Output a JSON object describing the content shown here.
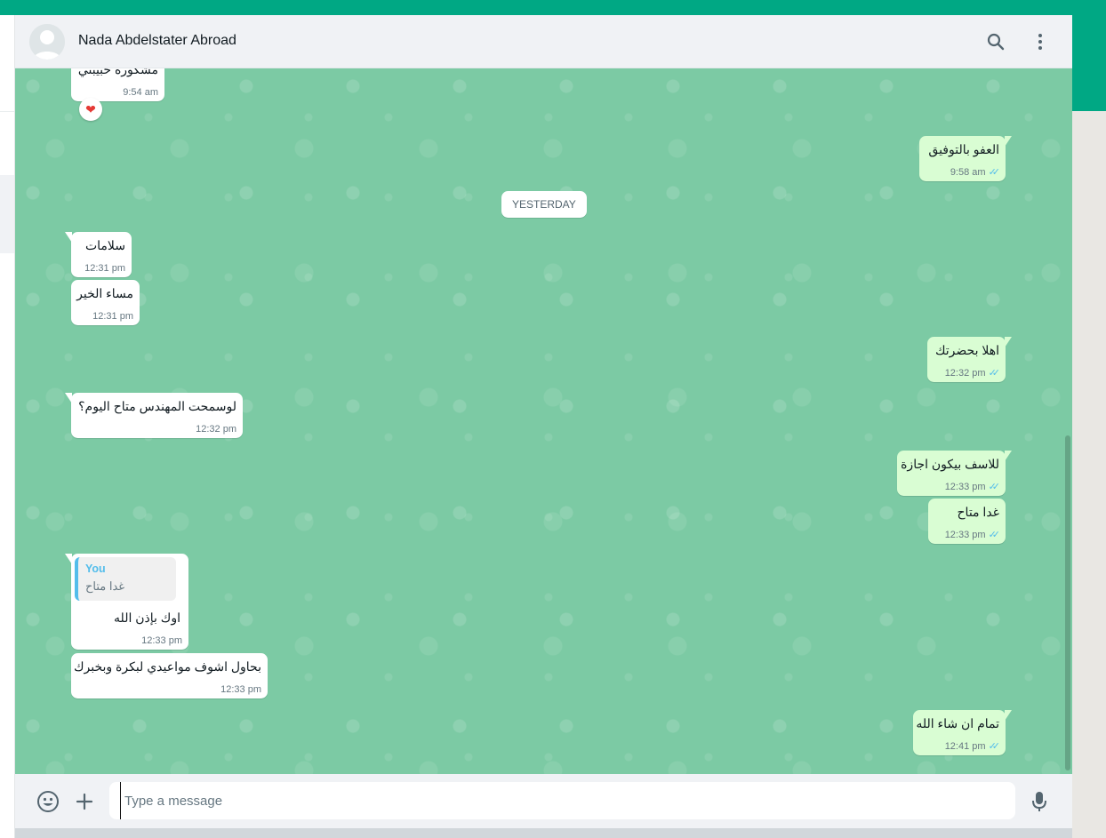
{
  "header": {
    "contact_name": "Nada Abdelstater Abroad"
  },
  "date_divider": "YESTERDAY",
  "messages": {
    "m0": {
      "text": "مشكورة حبيبتي",
      "time": "9:54 am"
    },
    "m0_reaction": "❤",
    "m1": {
      "text": "العفو بالتوفيق",
      "time": "9:58 am"
    },
    "m2": {
      "text": "سلامات",
      "time": "12:31 pm"
    },
    "m3": {
      "text": "مساء الخير",
      "time": "12:31 pm"
    },
    "m4": {
      "text": "اهلا بحضرتك",
      "time": "12:32 pm"
    },
    "m5": {
      "text": "لوسمحت المهندس متاح اليوم؟",
      "time": "12:32 pm"
    },
    "m6": {
      "text": "للاسف بيكون اجازة",
      "time": "12:33 pm"
    },
    "m7": {
      "text": "غدا متاح",
      "time": "12:33 pm"
    },
    "m8": {
      "quote_author": "You",
      "quote_text": "غدا متاح",
      "text": "اوك بإذن الله",
      "time": "12:33 pm"
    },
    "m9": {
      "text": "بحاول اشوف مواعيدي لبكرة وبخبرك",
      "time": "12:33 pm"
    },
    "m10": {
      "text": "تمام ان شاء الله",
      "time": "12:41 pm"
    }
  },
  "composer": {
    "placeholder": "Type a message"
  },
  "icons": {
    "search": "search-icon",
    "menu": "menu-icon",
    "emoji": "emoji-icon",
    "attach": "plus-icon",
    "mic": "mic-icon",
    "read_receipt": "double-check-icon"
  },
  "colors": {
    "brand": "#00a884",
    "wallpaper": "#7ccaa4",
    "outgoing_bubble": "#d9fdd3",
    "incoming_bubble": "#ffffff",
    "read_tick": "#53bdeb"
  }
}
